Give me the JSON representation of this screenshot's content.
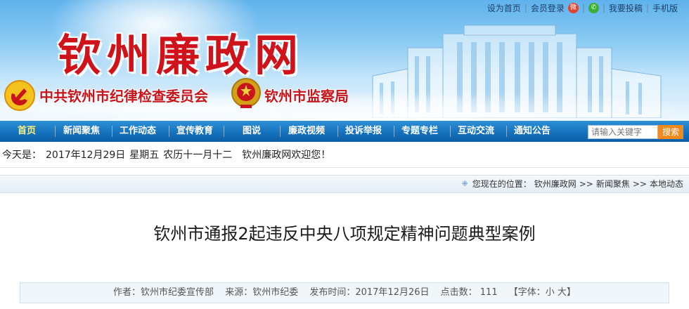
{
  "top_links": {
    "set_home": "设为首页",
    "member_login": "会员登录",
    "submit": "我要投稿",
    "mobile": "手机版",
    "weibo_icon": "weibo-icon",
    "wechat_icon": "wechat-icon"
  },
  "banner": {
    "site_title": "钦州廉政网",
    "commission": "中共钦州市纪律检查委员会",
    "supervision": "钦州市监察局",
    "title_color": "#d0131a"
  },
  "nav": {
    "items": [
      "首页",
      "新闻聚焦",
      "工作动态",
      "宣传教育",
      "图说",
      "廉政视频",
      "投诉举报",
      "专题专栏",
      "互动交流",
      "通知公告"
    ],
    "active_index": 0,
    "active_color": "#fff27a",
    "bar_color": "#1672bd"
  },
  "search": {
    "placeholder": "请输入关键字",
    "button": "搜索",
    "button_color": "#f08a1d"
  },
  "datebar": {
    "prefix": "今天是：",
    "date": "2017年12月29日",
    "weekday": "星期五",
    "lunar": "农历十一月十二",
    "welcome": "钦州廉政网欢迎您！"
  },
  "breadcrumb": {
    "prefix": "您现在的位置：",
    "items": [
      "钦州廉政网",
      "新闻聚焦",
      "本地动态"
    ],
    "separator": ">>"
  },
  "article": {
    "title": "钦州市通报2起违反中央八项规定精神问题典型案例",
    "author": "作者：钦州市纪委宣传部",
    "source": "来源：钦州市纪委",
    "published": "发布时间：2017年12月26日",
    "clicks": "点击数： 111",
    "font_label": "【字体：",
    "font_small": "小",
    "font_large": "大",
    "font_close": "】"
  }
}
